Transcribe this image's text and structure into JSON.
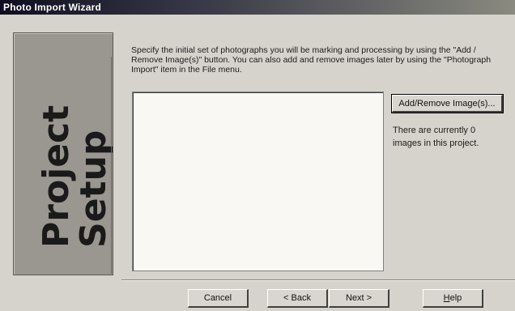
{
  "window": {
    "title": "Photo Import Wizard"
  },
  "side_panel": {
    "line1": "Project",
    "line2": "Setup"
  },
  "instructions": "Specify the initial set of photographs you will be marking and processing by using the \"Add / Remove Image(s)\" button. You can also add and remove images later by using the \"Photograph Import\" item in the File menu.",
  "image_list": {
    "items": []
  },
  "buttons": {
    "add_remove": "Add/Remove Image(s)...",
    "cancel": "Cancel",
    "back": "< Back",
    "next": "Next >",
    "help_prefix": "H",
    "help_rest": "elp"
  },
  "status": "There are currently 0 images in this project."
}
